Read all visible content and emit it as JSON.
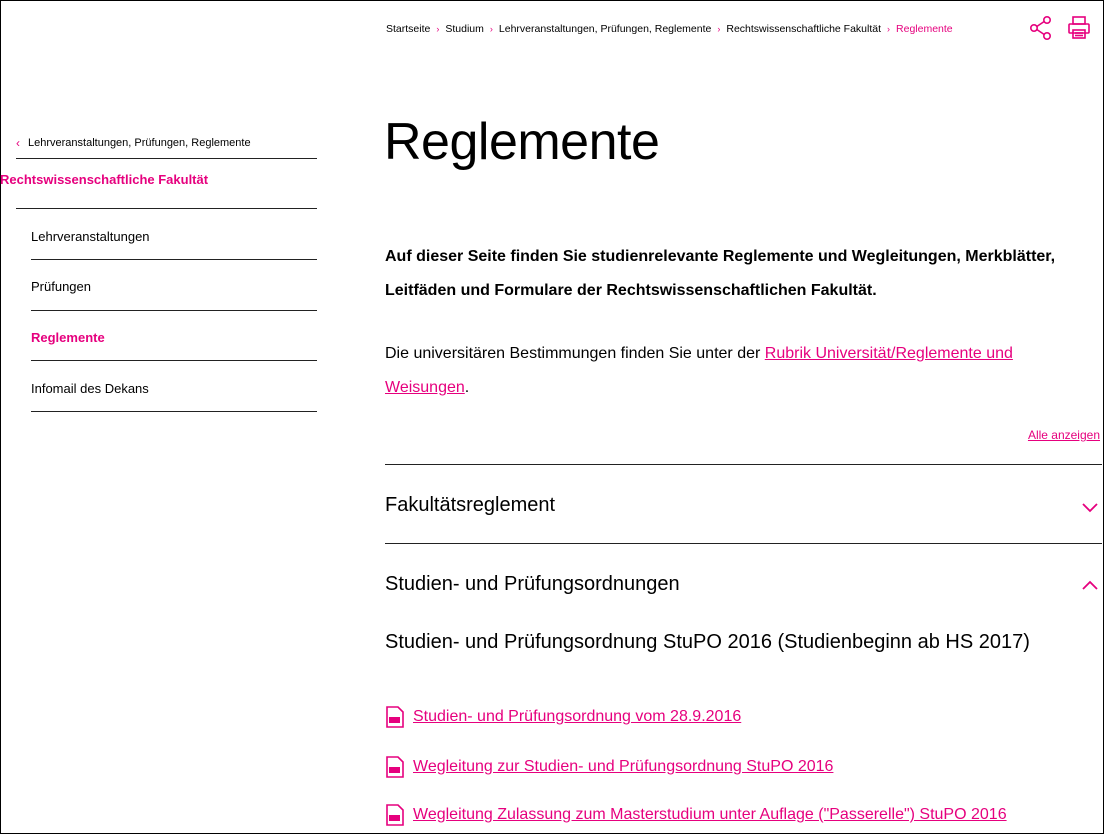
{
  "colors": {
    "accent": "#e6007e",
    "text": "#000000",
    "rule": "#222222"
  },
  "breadcrumb": {
    "items": [
      "Startseite",
      "Studium",
      "Lehrveranstaltungen, Prüfungen, Reglemente",
      "Rechtswissenschaftliche Fakultät",
      "Reglemente"
    ],
    "separator": "›"
  },
  "tools": {
    "share_icon": "share-icon",
    "print_icon": "printer-icon"
  },
  "sidebar": {
    "back_label": "Lehrveranstaltungen, Prüfungen, Reglemente",
    "faculty": "Rechtswissenschaftliche Fakultät",
    "items": [
      {
        "label": "Lehrveranstaltungen"
      },
      {
        "label": "Prüfungen"
      },
      {
        "label": "Reglemente",
        "active": true
      },
      {
        "label": "Infomail des Dekans"
      }
    ]
  },
  "main": {
    "title": "Reglemente",
    "lead": "Auf dieser Seite finden Sie studienrelevante Reglemente und Wegleitungen, Merkblätter, Leitfäden und Formulare der Rechtswissenschaftlichen Fakultät.",
    "para_before": "Die universitären Bestimmungen finden Sie unter der ",
    "para_link": "Rubrik Universität/Reglemente und Weisungen",
    "para_after": ".",
    "show_all": "Alle anzeigen",
    "accordions": [
      {
        "title": "Fakultätsreglement",
        "state": "collapsed"
      },
      {
        "title": "Studien- und Prüfungsordnungen",
        "state": "expanded"
      }
    ],
    "sub_heading": "Studien- und Prüfungsordnung StuPO 2016 (Studienbeginn ab HS 2017)",
    "documents": [
      {
        "label": "Studien- und Prüfungsordnung vom 28.9.2016",
        "icon": "pdf-icon"
      },
      {
        "label": "Wegleitung zur Studien- und Prüfungsordnung StuPO 2016",
        "icon": "pdf-icon"
      },
      {
        "label": "Wegleitung Zulassung zum Masterstudium unter Auflage (\"Passerelle\") StuPO 2016",
        "icon": "pdf-icon"
      }
    ]
  }
}
